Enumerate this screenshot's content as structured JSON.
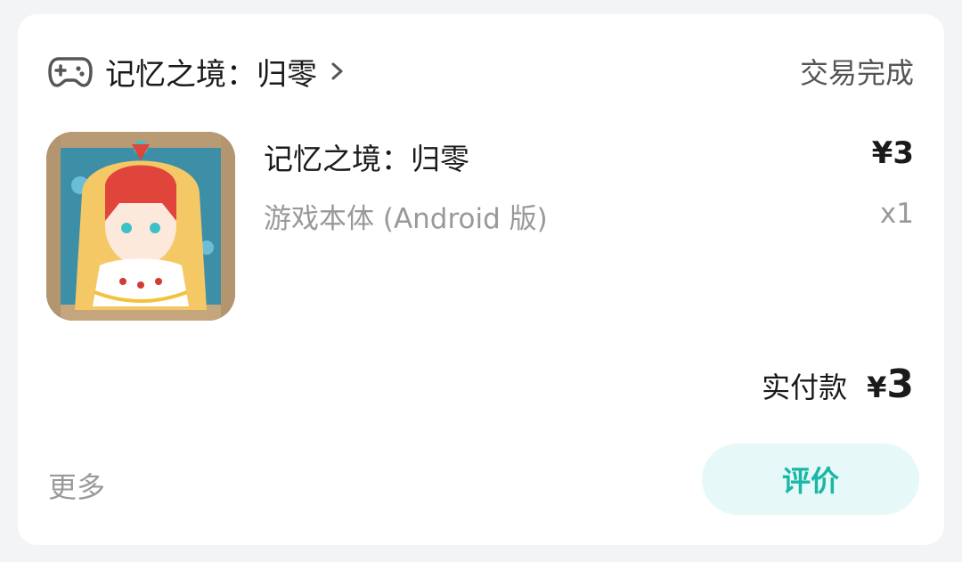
{
  "order": {
    "store_name": "记忆之境：归零",
    "status": "交易完成",
    "item": {
      "title": "记忆之境：归零",
      "variant": "游戏本体 (Android 版)",
      "price": "¥3",
      "quantity": "x1"
    },
    "total": {
      "label": "实付款",
      "currency": "¥",
      "amount": "3"
    },
    "more_label": "更多",
    "review_label": "评价"
  },
  "icons": {
    "header": "gamepad-icon",
    "chevron": "chevron-right-icon",
    "thumbnail": "game-cover-image"
  },
  "colors": {
    "accent": "#19b8a6",
    "accent_bg": "#e6f8f7",
    "muted_text": "#999999"
  }
}
